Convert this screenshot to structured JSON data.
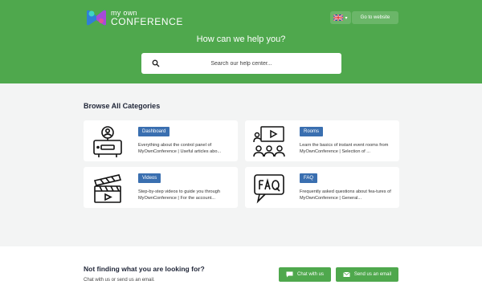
{
  "header": {
    "logo": {
      "line1": "my own",
      "line2": "CONFERENCE"
    },
    "language_flag": "uk-flag-icon",
    "goto_label": "Go to website"
  },
  "hero": {
    "title": "How can we help you?",
    "search_placeholder": "Search our help center..."
  },
  "categories": {
    "title": "Browse All Categories",
    "items": [
      {
        "tag": "Dashboard",
        "description": "Everything about the control panel of MyOwnConference | Useful articles abo...",
        "icon": "monitor-user-icon"
      },
      {
        "tag": "Rooms",
        "description": "Learn the basics of instant event rooms from MyOwnConference | Selection of ...",
        "icon": "presentation-audience-icon"
      },
      {
        "tag": "Videos",
        "description": "Step-by-step videos to guide you through MyOwnConference | For the account...",
        "icon": "clapperboard-icon"
      },
      {
        "tag": "FAQ",
        "description": "Frequently asked questions about fea-tures of MyOwnConference | General...",
        "icon": "faq-bubble-icon"
      }
    ]
  },
  "footer": {
    "title": "Not finding what you are looking for?",
    "subtitle": "Chat with us or send us an email.",
    "chat_label": "Chat with us",
    "email_label": "Send us an email"
  },
  "colors": {
    "brand_green": "#4fa84d",
    "tag_blue": "#3a6fb0"
  }
}
